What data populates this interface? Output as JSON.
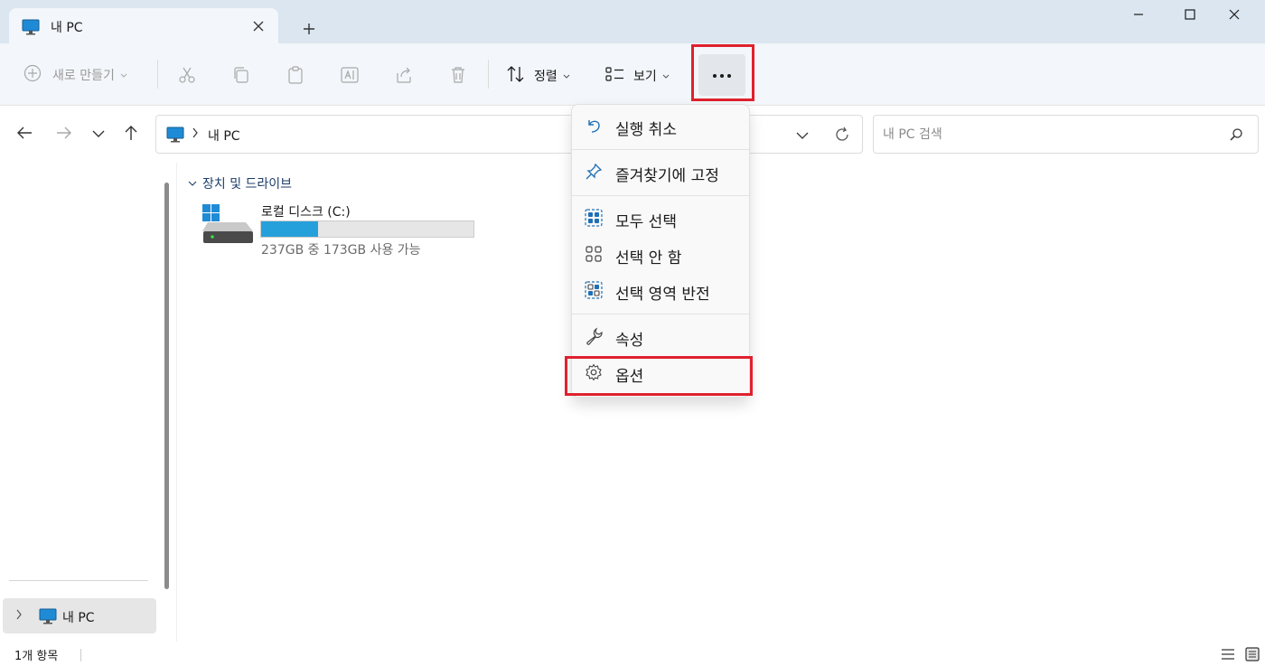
{
  "window": {
    "tab_title": "내 PC",
    "new_tab_glyph": "+",
    "icons": [
      "monitor-icon",
      "close-icon",
      "minimize-icon",
      "maximize-icon"
    ]
  },
  "toolbar": {
    "new_label": "새로 만들기",
    "sort_label": "정렬",
    "view_label": "보기",
    "more_glyph": "···",
    "icons": [
      "plus-circle-icon",
      "cut-icon",
      "copy-icon",
      "paste-icon",
      "rename-icon",
      "share-icon",
      "delete-icon",
      "sort-icon",
      "view-icon",
      "more-icon"
    ]
  },
  "address": {
    "path": "내 PC",
    "search_placeholder": "내 PC 검색"
  },
  "sidebar": {
    "items": [
      {
        "label": "내 PC"
      }
    ]
  },
  "content": {
    "group_title": "장치 및 드라이브",
    "drives": [
      {
        "name": "로컬 디스크 (C:)",
        "detail": "237GB 중 173GB 사용 가능",
        "used_fraction": 0.27
      }
    ]
  },
  "menu": {
    "items": [
      {
        "label": "실행 취소",
        "icon": "undo-icon"
      },
      {
        "label": "즐겨찾기에 고정",
        "icon": "pin-icon"
      },
      {
        "label": "모두 선택",
        "icon": "select-all-icon"
      },
      {
        "label": "선택 안 함",
        "icon": "select-none-icon"
      },
      {
        "label": "선택 영역 반전",
        "icon": "invert-selection-icon"
      },
      {
        "label": "속성",
        "icon": "wrench-icon"
      },
      {
        "label": "옵션",
        "icon": "gear-icon"
      }
    ]
  },
  "status": {
    "count_label": "1개 항목"
  },
  "colors": {
    "accent": "#26a0da",
    "highlight": "#e0212e",
    "titlebar": "#dbe6f1"
  }
}
